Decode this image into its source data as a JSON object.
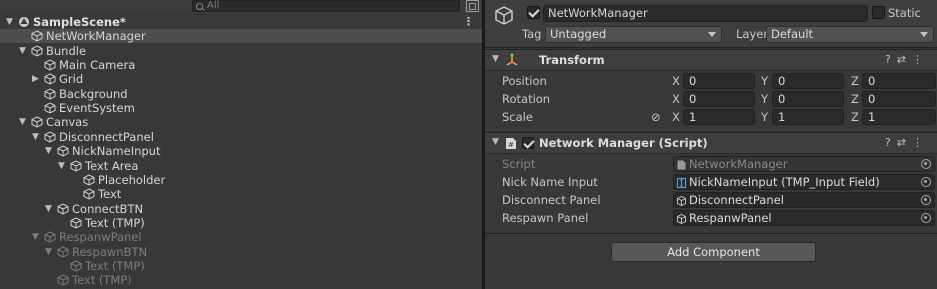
{
  "hierarchy": {
    "search_placeholder": "All",
    "items": [
      {
        "label": "SampleScene*",
        "indent": 0,
        "arrow": "▼",
        "type": "scene",
        "disabled": false,
        "selected": false
      },
      {
        "label": "NetWorkManager",
        "indent": 1,
        "arrow": "",
        "type": "go",
        "disabled": false,
        "selected": true
      },
      {
        "label": "Bundle",
        "indent": 1,
        "arrow": "▼",
        "type": "go",
        "disabled": false,
        "selected": false
      },
      {
        "label": "Main Camera",
        "indent": 2,
        "arrow": "",
        "type": "go",
        "disabled": false,
        "selected": false
      },
      {
        "label": "Grid",
        "indent": 2,
        "arrow": "▶",
        "type": "go",
        "disabled": false,
        "selected": false
      },
      {
        "label": "Background",
        "indent": 2,
        "arrow": "",
        "type": "go",
        "disabled": false,
        "selected": false
      },
      {
        "label": "EventSystem",
        "indent": 2,
        "arrow": "",
        "type": "go",
        "disabled": false,
        "selected": false
      },
      {
        "label": "Canvas",
        "indent": 1,
        "arrow": "▼",
        "type": "go",
        "disabled": false,
        "selected": false
      },
      {
        "label": "DisconnectPanel",
        "indent": 2,
        "arrow": "▼",
        "type": "go",
        "disabled": false,
        "selected": false
      },
      {
        "label": "NickNameInput",
        "indent": 3,
        "arrow": "▼",
        "type": "go",
        "disabled": false,
        "selected": false
      },
      {
        "label": "Text Area",
        "indent": 4,
        "arrow": "▼",
        "type": "go",
        "disabled": false,
        "selected": false
      },
      {
        "label": "Placeholder",
        "indent": 5,
        "arrow": "",
        "type": "go",
        "disabled": false,
        "selected": false
      },
      {
        "label": "Text",
        "indent": 5,
        "arrow": "",
        "type": "go",
        "disabled": false,
        "selected": false
      },
      {
        "label": "ConnectBTN",
        "indent": 3,
        "arrow": "▼",
        "type": "go",
        "disabled": false,
        "selected": false
      },
      {
        "label": "Text (TMP)",
        "indent": 4,
        "arrow": "",
        "type": "go",
        "disabled": false,
        "selected": false
      },
      {
        "label": "RespanwPanel",
        "indent": 2,
        "arrow": "▼",
        "type": "go",
        "disabled": true,
        "selected": false
      },
      {
        "label": "RespawnBTN",
        "indent": 3,
        "arrow": "▼",
        "type": "go",
        "disabled": true,
        "selected": false
      },
      {
        "label": "Text (TMP)",
        "indent": 4,
        "arrow": "",
        "type": "go",
        "disabled": true,
        "selected": false
      },
      {
        "label": "Text (TMP)",
        "indent": 3,
        "arrow": "",
        "type": "go",
        "disabled": true,
        "selected": false
      }
    ]
  },
  "inspector": {
    "object_name": "NetWorkManager",
    "static_label": "Static",
    "tag_label": "Tag",
    "tag_value": "Untagged",
    "layer_label": "Layer",
    "layer_value": "Default",
    "transform": {
      "title": "Transform",
      "rows": [
        {
          "label": "Position",
          "x": "0",
          "y": "0",
          "z": "0"
        },
        {
          "label": "Rotation",
          "x": "0",
          "y": "0",
          "z": "0"
        },
        {
          "label": "Scale",
          "x": "1",
          "y": "1",
          "z": "1"
        }
      ],
      "axis_x": "X",
      "axis_y": "Y",
      "axis_z": "Z"
    },
    "script_component": {
      "title": "Network Manager (Script)",
      "fields": [
        {
          "label": "Script",
          "value": "NetworkManager",
          "dim": true
        },
        {
          "label": "Nick Name Input",
          "value": "NickNameInput (TMP_Input Field)",
          "dim": false
        },
        {
          "label": "Disconnect Panel",
          "value": "DisconnectPanel",
          "dim": false
        },
        {
          "label": "Respawn Panel",
          "value": "RespanwPanel",
          "dim": false
        }
      ]
    },
    "add_component_label": "Add Component"
  }
}
